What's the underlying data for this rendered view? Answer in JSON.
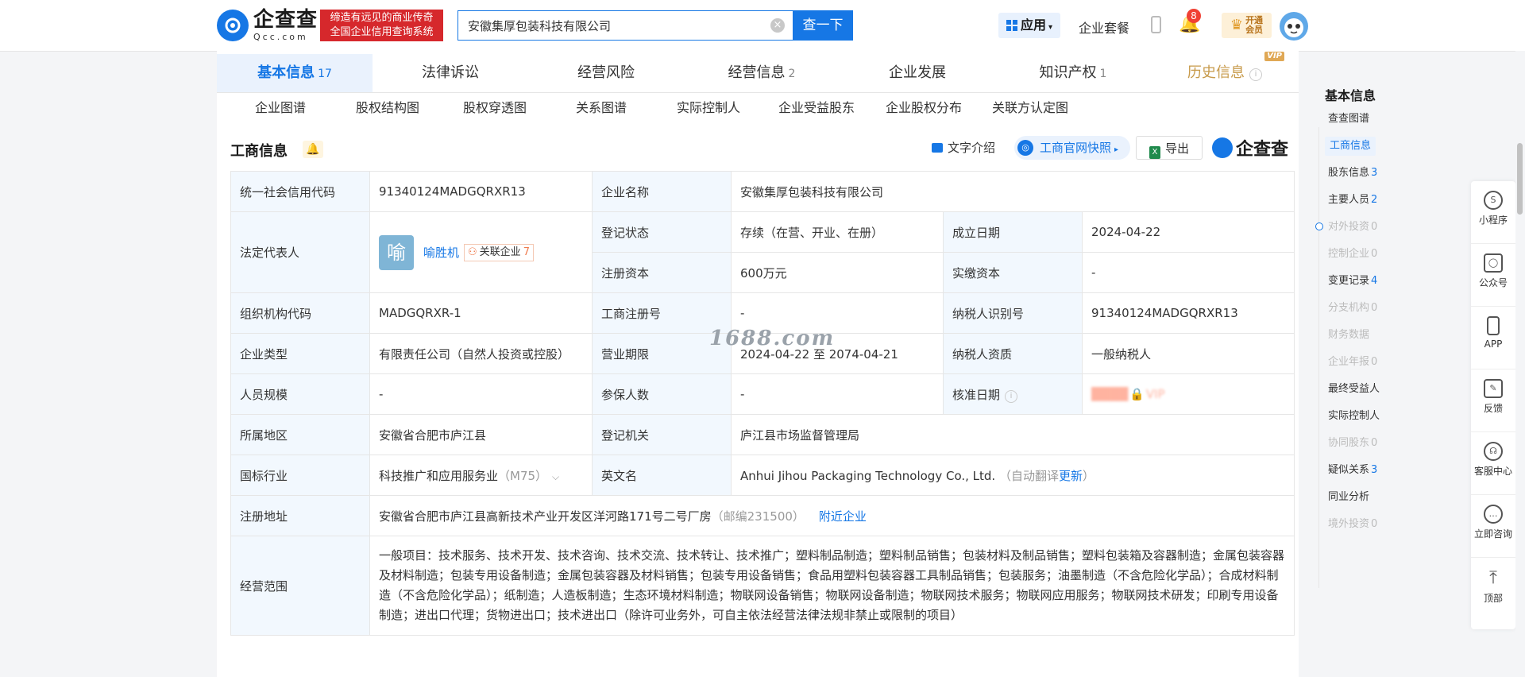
{
  "header": {
    "logo_cn": "企查查",
    "logo_en": "Qcc.com",
    "slogan_line1": "缔造有远见的商业传奇",
    "slogan_line2": "全国企业信用查询系统",
    "search_value": "安徽集厚包装科技有限公司",
    "search_clear": "×",
    "search_button": "查一下",
    "apps_label": "应用",
    "suite_label": "企业套餐",
    "notification_count": "8",
    "vip_line1": "开通",
    "vip_line2": "会员"
  },
  "tabs": [
    {
      "label": "基本信息",
      "count": "17"
    },
    {
      "label": "法律诉讼",
      "count": ""
    },
    {
      "label": "经营风险",
      "count": ""
    },
    {
      "label": "经营信息",
      "count": "2"
    },
    {
      "label": "企业发展",
      "count": ""
    },
    {
      "label": "知识产权",
      "count": "1"
    },
    {
      "label": "历史信息",
      "count": "",
      "badge": "VIP"
    }
  ],
  "subtabs": [
    "企业图谱",
    "股权结构图",
    "股权穿透图",
    "关系图谱",
    "实际控制人",
    "企业受益股东",
    "企业股权分布",
    "关联方认定图"
  ],
  "section": {
    "title": "工商信息",
    "text_intro": "文字介绍",
    "gs_snapshot": "工商官网快照",
    "export": "导出",
    "brand": "企查查"
  },
  "table": {
    "credit_code_label": "统一社会信用代码",
    "credit_code": "91340124MADGQRXR13",
    "company_name_label": "企业名称",
    "company_name": "安徽集厚包装科技有限公司",
    "legal_rep_label": "法定代表人",
    "legal_rep_avatar": "喻",
    "legal_rep_name": "喻胜机",
    "related_label": "关联企业",
    "related_count": "7",
    "reg_status_label": "登记状态",
    "reg_status": "存续（在营、开业、在册）",
    "est_date_label": "成立日期",
    "est_date": "2024-04-22",
    "reg_capital_label": "注册资本",
    "reg_capital": "600万元",
    "paid_capital_label": "实缴资本",
    "paid_capital": "-",
    "org_code_label": "组织机构代码",
    "org_code": "MADGQRXR-1",
    "biz_reg_no_label": "工商注册号",
    "biz_reg_no": "-",
    "taxpayer_id_label": "纳税人识别号",
    "taxpayer_id": "91340124MADGQRXR13",
    "company_type_label": "企业类型",
    "company_type": "有限责任公司（自然人投资或控股）",
    "biz_term_label": "营业期限",
    "biz_term": "2024-04-22 至 2074-04-21",
    "taxpayer_qual_label": "纳税人资质",
    "taxpayer_qual": "一般纳税人",
    "staff_size_label": "人员规模",
    "staff_size": "-",
    "insured_label": "参保人数",
    "insured": "-",
    "approval_date_label": "核准日期",
    "approval_blur": "VIP",
    "region_label": "所属地区",
    "region": "安徽省合肥市庐江县",
    "reg_authority_label": "登记机关",
    "reg_authority": "庐江县市场监督管理局",
    "industry_label": "国标行业",
    "industry": "科技推广和应用服务业",
    "industry_code": "（M75）",
    "english_name_label": "英文名",
    "english_name": "Anhui Jihou Packaging Technology Co., Ltd.",
    "auto_translate_prefix": "（自动翻译",
    "auto_translate_link": "更新",
    "auto_translate_suffix": "）",
    "address_label": "注册地址",
    "address": "安徽省合肥市庐江县高新技术产业开发区洋河路171号二号厂房",
    "postcode": "（邮编231500）",
    "nearby_link": "附近企业",
    "scope_label": "经营范围",
    "scope": "一般项目：技术服务、技术开发、技术咨询、技术交流、技术转让、技术推广；塑料制品制造；塑料制品销售；包装材料及制品销售；塑料包装箱及容器制造；金属包装容器及材料制造；包装专用设备制造；金属包装容器及材料销售；包装专用设备销售；食品用塑料包装容器工具制品销售；包装服务；油墨制造（不含危险化学品）；合成材料制造（不含危险化学品）；纸制造；人造板制造；生态环境材料制造；物联网设备销售；物联网设备制造；物联网技术服务；物联网应用服务；物联网技术研发；印刷专用设备制造；进出口代理；货物进出口；技术进出口（除许可业务外，可自主依法经营法律法规非禁止或限制的项目）"
  },
  "watermark": "1688.com",
  "right_nav": {
    "title": "基本信息",
    "items": [
      {
        "label": "查查图谱",
        "count": "",
        "state": "normal"
      },
      {
        "label": "工商信息",
        "count": "",
        "state": "active"
      },
      {
        "label": "股东信息",
        "count": "3",
        "state": "normal"
      },
      {
        "label": "主要人员",
        "count": "2",
        "state": "normal"
      },
      {
        "label": "对外投资",
        "count": "0",
        "state": "dim"
      },
      {
        "label": "控制企业",
        "count": "0",
        "state": "dim"
      },
      {
        "label": "变更记录",
        "count": "4",
        "state": "normal"
      },
      {
        "label": "分支机构",
        "count": "0",
        "state": "dim"
      },
      {
        "label": "财务数据",
        "count": "",
        "state": "dim"
      },
      {
        "label": "企业年报",
        "count": "0",
        "state": "dim"
      },
      {
        "label": "最终受益人",
        "count": "",
        "state": "normal"
      },
      {
        "label": "实际控制人",
        "count": "",
        "state": "normal"
      },
      {
        "label": "协同股东",
        "count": "0",
        "state": "dim"
      },
      {
        "label": "疑似关系",
        "count": "3",
        "state": "normal"
      },
      {
        "label": "同业分析",
        "count": "",
        "state": "normal"
      },
      {
        "label": "境外投资",
        "count": "0",
        "state": "dim"
      }
    ]
  },
  "float_bar": [
    {
      "label": "小程序",
      "icon": "miniprogram-icon"
    },
    {
      "label": "公众号",
      "icon": "wechat-account-icon"
    },
    {
      "label": "APP",
      "icon": "app-icon"
    },
    {
      "label": "反馈",
      "icon": "feedback-icon"
    },
    {
      "label": "客服中心",
      "icon": "headset-icon"
    },
    {
      "label": "立即咨询",
      "icon": "chat-icon"
    },
    {
      "label": "顶部",
      "icon": "back-to-top-icon"
    }
  ]
}
